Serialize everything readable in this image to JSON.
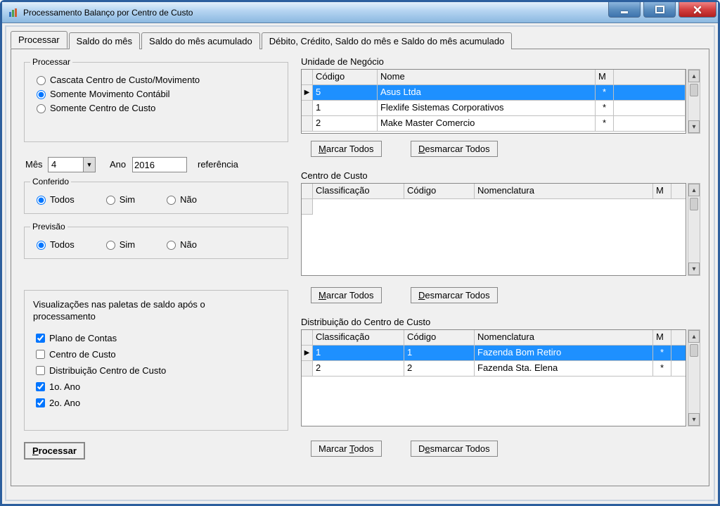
{
  "window": {
    "title": "Processamento Balanço por Centro de Custo"
  },
  "tabs": {
    "processar": "Processar",
    "saldo_mes": "Saldo do mês",
    "saldo_mes_acum": "Saldo do mês acumulado",
    "saldo_full": "Débito, Crédito, Saldo do mês e Saldo do mês acumulado"
  },
  "processar_group": {
    "legend": "Processar",
    "cascata": "Cascata Centro de Custo/Movimento",
    "somente_mov": "Somente Movimento Contábil",
    "somente_cc": "Somente Centro de Custo"
  },
  "periodo": {
    "mes_label": "Mês",
    "mes_value": "4",
    "ano_label": "Ano",
    "ano_value": "2016",
    "ref_label": "referência"
  },
  "conferido": {
    "legend": "Conferido",
    "todos": "Todos",
    "sim": "Sim",
    "nao": "Não"
  },
  "previsao": {
    "legend": "Previsão",
    "todos": "Todos",
    "sim": "Sim",
    "nao": "Não"
  },
  "viz": {
    "title": "Visualizações nas paletas de saldo após o processamento",
    "plano": "Plano de Contas",
    "centro": "Centro de Custo",
    "dist": "Distribuição Centro de Custo",
    "ano1": "1o. Ano",
    "ano2": "2o. Ano"
  },
  "processar_btn": "Processar",
  "unidade": {
    "label": "Unidade de Negócio",
    "cols": {
      "codigo": "Código",
      "nome": "Nome",
      "m": "M"
    },
    "rows": [
      {
        "codigo": "5",
        "nome": "Asus Ltda",
        "m": "*"
      },
      {
        "codigo": "1",
        "nome": "Flexlife Sistemas Corporativos",
        "m": "*"
      },
      {
        "codigo": "2",
        "nome": "Make Master Comercio",
        "m": "*"
      }
    ],
    "marcar": "Marcar Todos",
    "desmarcar": "Desmarcar Todos"
  },
  "centro_custo": {
    "label": "Centro de Custo",
    "cols": {
      "class": "Classificação",
      "codigo": "Código",
      "nomen": "Nomenclatura",
      "m": "M"
    },
    "rows": [],
    "marcar": "Marcar Todos",
    "desmarcar": "Desmarcar Todos"
  },
  "distrib": {
    "label": "Distribuição do Centro de Custo",
    "cols": {
      "class": "Classificação",
      "codigo": "Código",
      "nomen": "Nomenclatura",
      "m": "M"
    },
    "rows": [
      {
        "class": "1",
        "codigo": "1",
        "nomen": "Fazenda Bom Retiro",
        "m": "*"
      },
      {
        "class": "2",
        "codigo": "2",
        "nomen": "Fazenda Sta. Elena",
        "m": "*"
      }
    ],
    "marcar": "Marcar Todos",
    "desmarcar": "Desmarcar Todos"
  }
}
